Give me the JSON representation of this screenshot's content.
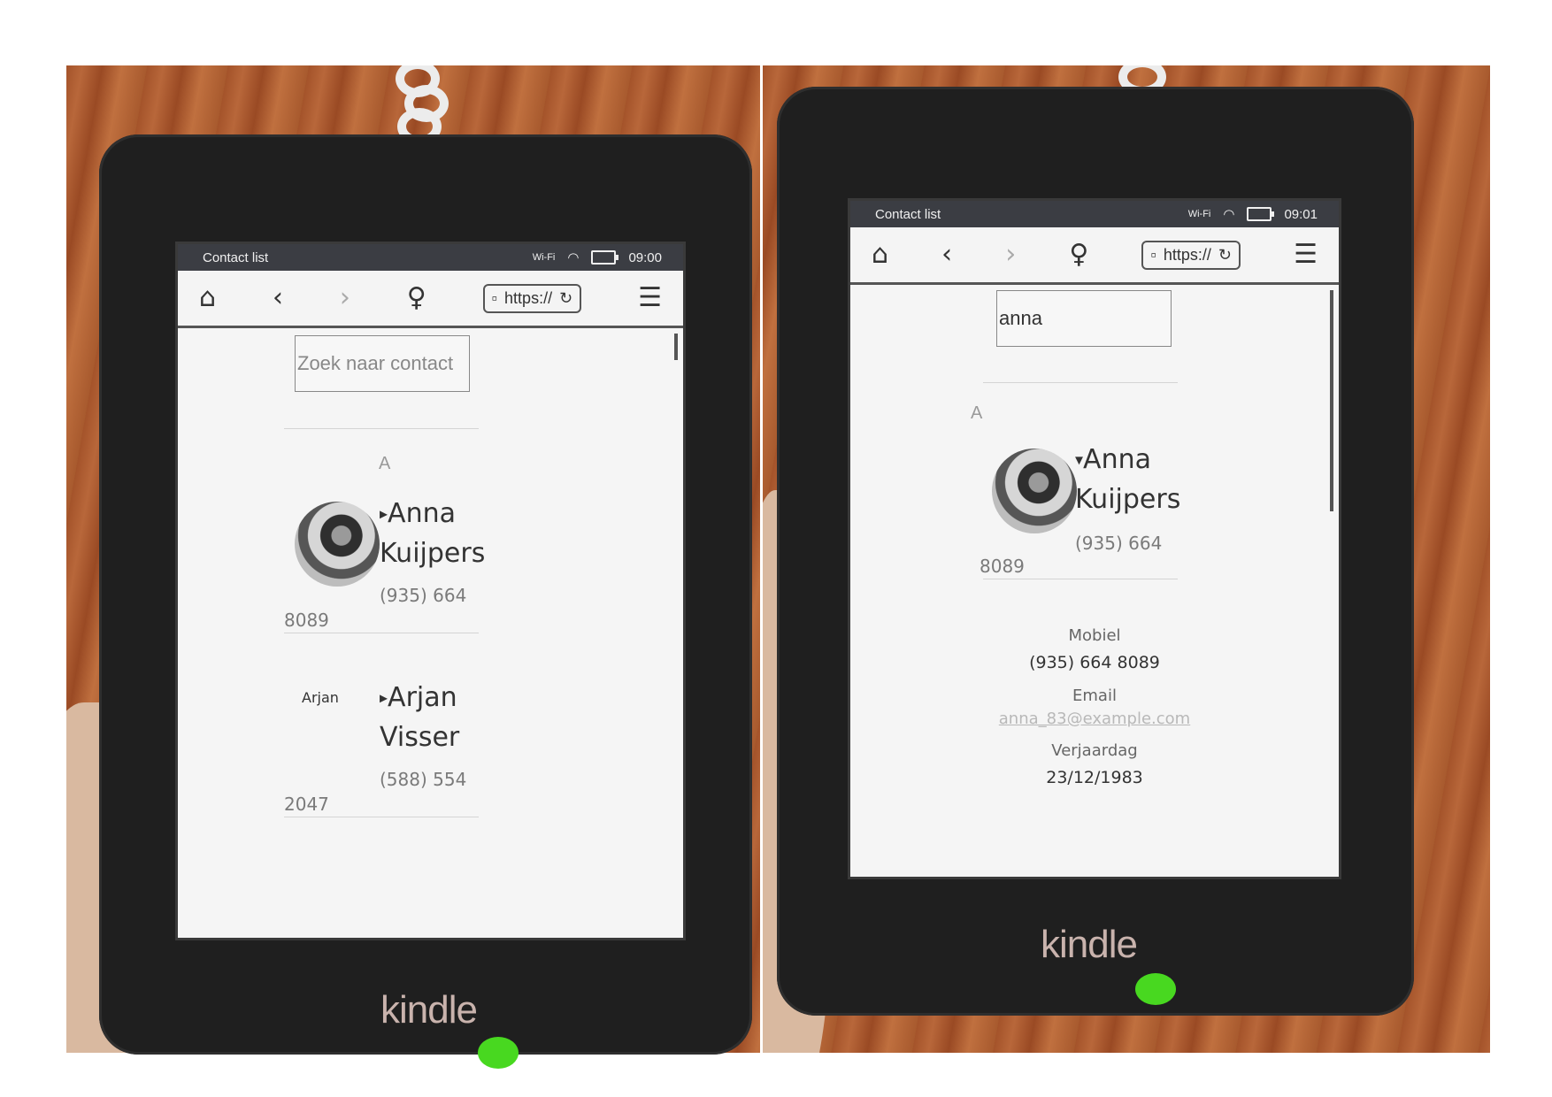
{
  "brand": {
    "logo": "kindle"
  },
  "colors": {
    "status_bar": "#3b3d43",
    "led": "#48d820",
    "screen": "#f3f3f3"
  },
  "left": {
    "status": {
      "title": "Contact list",
      "wifi": "Wi-Fi",
      "time": "09:00"
    },
    "toolbar": {
      "home_icon": "home-icon",
      "back_icon": "back-icon",
      "forward_icon": "forward-icon",
      "bulb_icon": "lightbulb-icon",
      "url": "https://",
      "reload_icon": "reload-icon",
      "menu_icon": "menu-icon"
    },
    "search": {
      "placeholder": "Zoek naar contact",
      "value": ""
    },
    "section_letter": "A",
    "contacts": [
      {
        "caret": "▸",
        "first": "Anna",
        "last": "Kuijpers",
        "phone_a": "(935) 664",
        "phone_b": "8089"
      },
      {
        "caret": "▸",
        "first": "Arjan",
        "last": "Visser",
        "phone_a": "(588) 554",
        "phone_b": "2047",
        "avatar_alt": "Arjan"
      }
    ]
  },
  "right": {
    "status": {
      "title": "Contact list",
      "wifi": "Wi-Fi",
      "time": "09:01"
    },
    "toolbar": {
      "url": "https://"
    },
    "search": {
      "value": "anna"
    },
    "section_letter": "A",
    "contact": {
      "caret": "▾",
      "first": "Anna",
      "last": "Kuijpers",
      "phone_a": "(935) 664",
      "phone_b": "8089"
    },
    "details": {
      "mobile_label": "Mobiel",
      "mobile_value": "(935) 664 8089",
      "email_label": "Email",
      "email_value": "anna_83@example.com",
      "birthday_label": "Verjaardag",
      "birthday_value": "23/12/1983"
    }
  }
}
